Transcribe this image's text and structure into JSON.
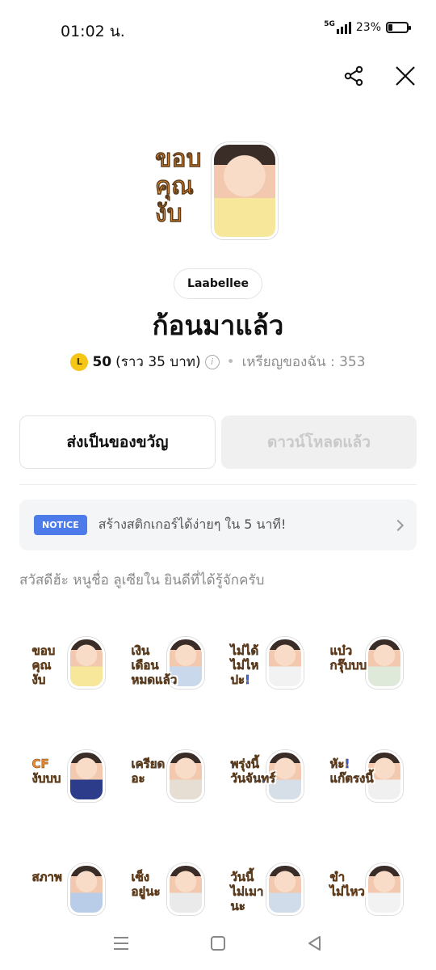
{
  "status": {
    "time": "01:02 น.",
    "network": "5G",
    "battery": "23%",
    "battery_level": 0.23
  },
  "pack": {
    "author": "Laabellee",
    "title": "ก้อนมาแล้ว",
    "price_value": "50",
    "price_note": "(ราว 35 บาท)",
    "coin_label": "L",
    "my_coins": "เหรียญของฉัน : 353",
    "description": "สวัสดีฮ้ะ หนูชื่อ ลูเซียใน ยินดีที่ได้รู้จักครับ",
    "main_caption": "ขอบ\nคุณ\nงับ"
  },
  "actions": {
    "gift": "ส่งเป็นของขวัญ",
    "downloaded": "ดาวน์โหลดแล้ว"
  },
  "notice": {
    "badge": "NOTICE",
    "text": "สร้างสติกเกอร์ได้ง่ายๆ ใน 5 นาที!"
  },
  "stickers": [
    {
      "caption": "ขอบ\nคุณ\nงับ",
      "color": "#f39a3a",
      "shirt": "#f6e79b"
    },
    {
      "caption": "เงิน\nเดือน\nหมดแล้ว",
      "color": "#4a8fd8",
      "shirt": "#c9d8ea"
    },
    {
      "caption": "ไม่ได้\nไม่ไห\nปะ!",
      "color": "#3a6fd8",
      "shirt": "#f2f2f2"
    },
    {
      "caption": "แบ๋ว\nกรุ๊บบบ",
      "color": "#e0609a",
      "shirt": "#dfe9d9"
    },
    {
      "caption": "CF\nงับบบ",
      "color": "#f08a2a",
      "shirt": "#2c3c8a"
    },
    {
      "caption": "เครียด\nอะ",
      "color": "#3a86e0",
      "shirt": "#e6ded2"
    },
    {
      "caption": "พรุ่งนี้\nวันจันทร์",
      "color": "#2f6fd8",
      "shirt": "#d6dfe8"
    },
    {
      "caption": "หัะ!\nแก๊ตรงนี้",
      "color": "#3a5ee0",
      "shirt": "#f0f0f0"
    },
    {
      "caption": "สภาพ",
      "color": "#f0842a",
      "shirt": "#b9cde8"
    },
    {
      "caption": "เซ็ง\nอยู่นะ",
      "color": "#e07a2a",
      "shirt": "#eaeaea"
    },
    {
      "caption": "วันนี้\nไม่เมา\nนะ",
      "color": "#4a8fd8",
      "shirt": "#d0dcea"
    },
    {
      "caption": "ขำ\nไม่ไหว",
      "color": "#f0842a",
      "shirt": "#f2f2f2"
    }
  ]
}
